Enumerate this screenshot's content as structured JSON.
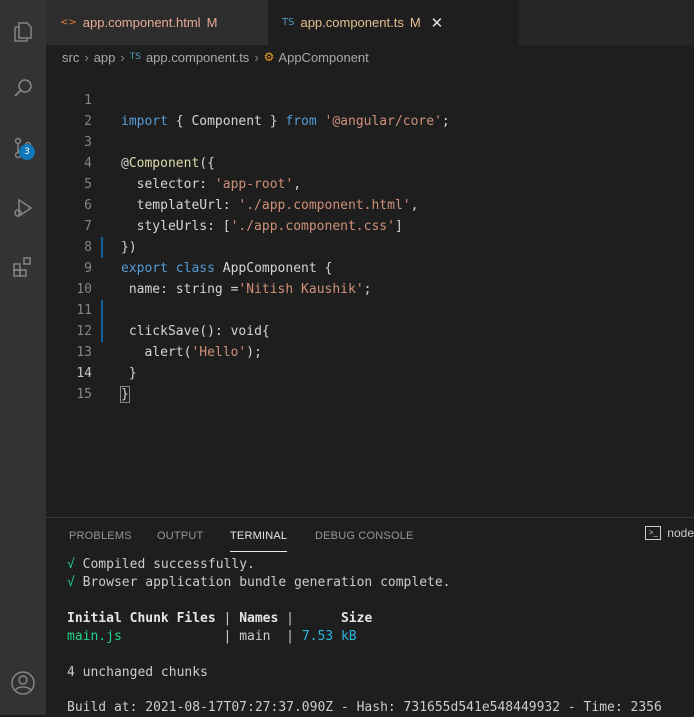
{
  "tabs": [
    {
      "icon": "<>",
      "label": "app.component.html",
      "modified": "M"
    },
    {
      "icon": "TS",
      "label": "app.component.ts",
      "modified": "M",
      "close": "✕"
    }
  ],
  "breadcrumb": {
    "src": "src",
    "app": "app",
    "ts_icon": "TS",
    "file": "app.component.ts",
    "symbol": "AppComponent"
  },
  "activity_badge": "3",
  "line_numbers": [
    "1",
    "2",
    "3",
    "4",
    "5",
    "6",
    "7",
    "8",
    "9",
    "10",
    "11",
    "12",
    "13",
    "14",
    "15"
  ],
  "code": {
    "l1": {
      "a": "import",
      "b": " { Component } ",
      "c": "from",
      "d": " ",
      "e": "'@angular/core'",
      "f": ";"
    },
    "l3": {
      "a": "@",
      "b": "Component",
      "c": "({"
    },
    "l4": {
      "a": "  selector: ",
      "b": "'app-root'",
      "c": ","
    },
    "l5": {
      "a": "  templateUrl: ",
      "b": "'./app.component.html'",
      "c": ","
    },
    "l6": {
      "a": "  styleUrls: [",
      "b": "'./app.component.css'",
      "c": "]"
    },
    "l7": {
      "a": "})"
    },
    "l8": {
      "a": "export",
      "b": " ",
      "c": "class",
      "d": " ",
      "e": "AppComponent",
      "f": " {"
    },
    "l9": {
      "a": " name: ",
      "b": "string",
      "c": " =",
      "d": "'Nitish Kaushik'",
      "e": ";"
    },
    "l11": {
      "a": " clickSave",
      "b": "(): ",
      "c": "void",
      "d": "{"
    },
    "l12": {
      "a": "   alert",
      "b": "(",
      "c": "'Hello'",
      "d": ");"
    },
    "l13": {
      "a": " }"
    },
    "l14": {
      "a": "}"
    }
  },
  "panel": {
    "tabs": [
      "PROBLEMS",
      "OUTPUT",
      "TERMINAL",
      "DEBUG CONSOLE"
    ],
    "terminal_selector": "node"
  },
  "terminal": {
    "check": "√",
    "line1": " Compiled successfully.",
    "line2": " Browser application bundle generation complete.",
    "hdr_files": "Initial Chunk Files",
    "hdr_sep1": " | ",
    "hdr_names": "Names",
    "hdr_sep2": " |      ",
    "hdr_size": "Size",
    "row_file": "main.js",
    "row_sep1": "             | ",
    "row_name": "main",
    "row_sep2": "  | ",
    "row_size": "7.53 kB",
    "unchanged": "4 unchanged chunks",
    "build": "Build at: 2021-08-17T07:27:37.090Z - Hash: 731655d541e548449932 - Time: 2356"
  }
}
